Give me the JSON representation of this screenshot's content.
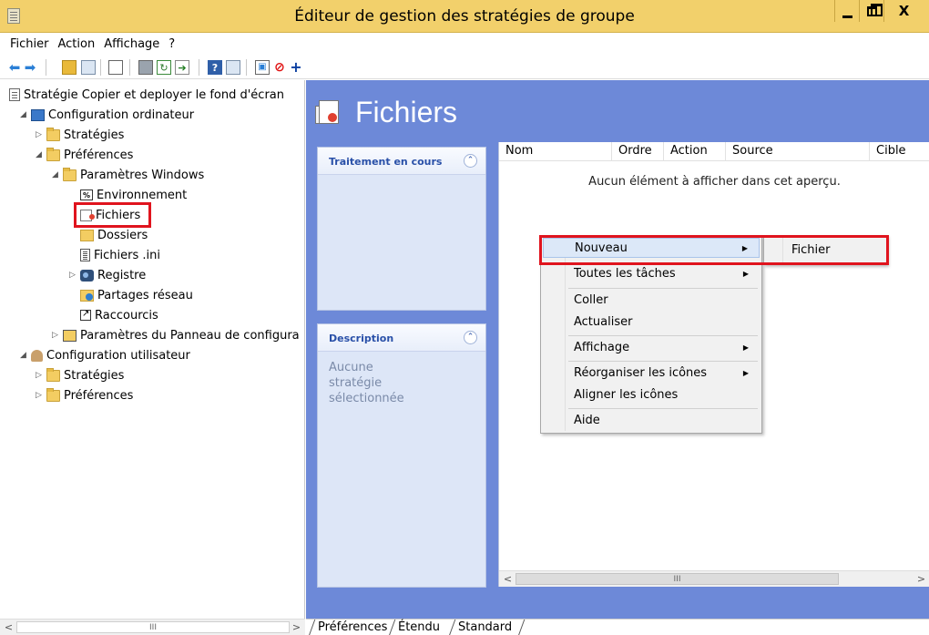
{
  "window": {
    "title": "Éditeur de gestion des stratégies de groupe"
  },
  "menubar": [
    "Fichier",
    "Action",
    "Affichage",
    "?"
  ],
  "toolbar_icons": [
    "back-arrow-icon",
    "forward-arrow-icon",
    "up-folder-icon",
    "show-hide-tree-icon",
    "copy-icon",
    "print-icon",
    "refresh-icon",
    "export-list-icon",
    "help-icon",
    "show-hide-action-pane-icon",
    "properties-icon",
    "stop-processing-icon",
    "add-icon"
  ],
  "tree": {
    "root": "Stratégie Copier et deployer le fond d'écran",
    "computer_config": "Configuration ordinateur",
    "computer_policies": "Stratégies",
    "computer_preferences": "Préférences",
    "windows_settings": "Paramètres Windows",
    "environment": "Environnement",
    "files": "Fichiers",
    "folders": "Dossiers",
    "ini_files": "Fichiers .ini",
    "registry": "Registre",
    "network_shares": "Partages réseau",
    "shortcuts": "Raccourcis",
    "control_panel": "Paramètres du Panneau de configura",
    "user_config": "Configuration utilisateur",
    "user_policies": "Stratégies",
    "user_preferences": "Préférences"
  },
  "rightpane": {
    "title": "Fichiers",
    "processing_panel": {
      "header": "Traitement en cours"
    },
    "description_panel": {
      "header": "Description",
      "body": "Aucune stratégie sélectionnée"
    },
    "columns": [
      "Nom",
      "Ordre",
      "Action",
      "Source",
      "Cible"
    ],
    "empty_message": "Aucun élément à afficher dans cet aperçu."
  },
  "context_menu": {
    "new": "Nouveau",
    "all_tasks": "Toutes les tâches",
    "paste": "Coller",
    "refresh": "Actualiser",
    "view": "Affichage",
    "arrange_icons": "Réorganiser les icônes",
    "line_up_icons": "Aligner les icônes",
    "help": "Aide"
  },
  "submenu": {
    "file": "Fichier"
  },
  "tabs": [
    "Préférences",
    "Étendu",
    "Standard"
  ],
  "scrollbar_thumb_glyph": "III",
  "colors": {
    "titlebar": "#f2d06b",
    "pane_background": "#6d89d8",
    "highlight_outline": "#e0141e"
  }
}
